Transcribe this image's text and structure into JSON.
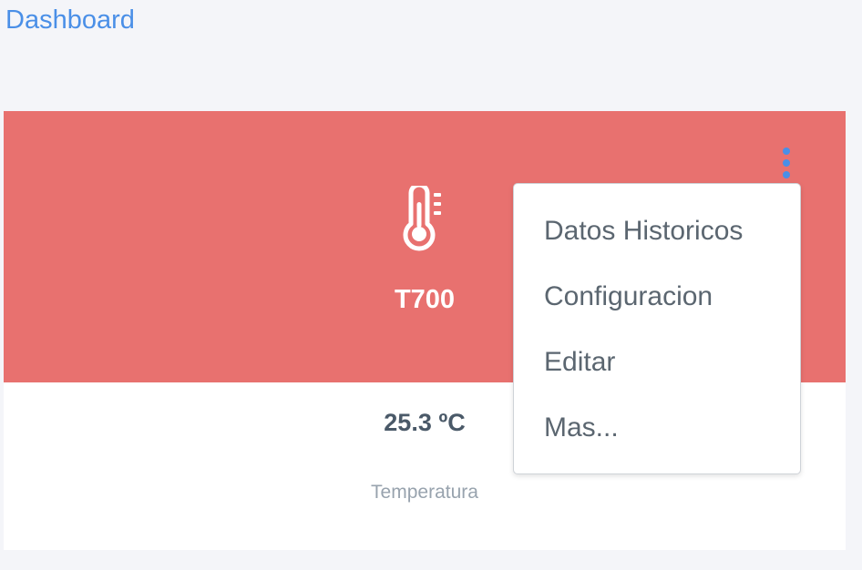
{
  "header": {
    "title": "Dashboard"
  },
  "device_card": {
    "name": "T700",
    "icon": "thermometer-icon",
    "header_color": "#e8716f",
    "reading": {
      "value": "25.3 ºC",
      "label": "Temperatura"
    }
  },
  "menu": {
    "trigger_icon": "kebab-menu-icon",
    "items": [
      {
        "label": "Datos Historicos"
      },
      {
        "label": "Configuracion"
      },
      {
        "label": "Editar"
      },
      {
        "label": "Mas..."
      }
    ]
  },
  "colors": {
    "accent": "#4a8fe7",
    "background": "#f4f5f9"
  }
}
